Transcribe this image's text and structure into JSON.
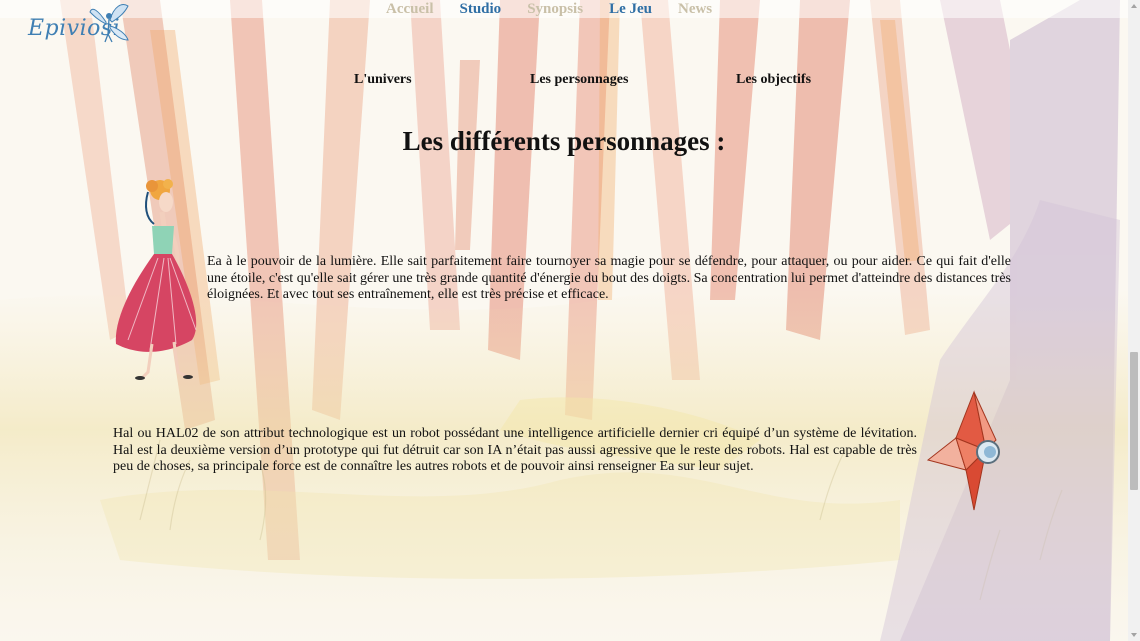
{
  "logo": {
    "text": "Epiviosi"
  },
  "nav": {
    "items": [
      {
        "label": "Accueil",
        "state": "muted"
      },
      {
        "label": "Studio",
        "state": "active"
      },
      {
        "label": "Synopsis",
        "state": "muted"
      },
      {
        "label": "Le Jeu",
        "state": "active"
      },
      {
        "label": "News",
        "state": "muted"
      }
    ]
  },
  "subnav": {
    "items": [
      {
        "label": "L'univers"
      },
      {
        "label": "Les personnages"
      },
      {
        "label": "Les objectifs"
      }
    ]
  },
  "page": {
    "title": "Les différents personnages :"
  },
  "characters": [
    {
      "illustration": "ea-character-illustration",
      "text": "Ea à le pouvoir de la lumière. Elle sait parfaitement faire tournoyer sa magie pour se défendre, pour attaquer, ou pour aider. Ce qui fait d'elle une étoile, c'est qu'elle sait gérer une très grande quantité d'énergie du bout des doigts. Sa concentration lui permet d'atteindre des distances très éloignées. Et avec tout ses entraînement, elle est très précise et efficace."
    },
    {
      "illustration": "hal-robot-illustration",
      "text": "Hal ou HAL02 de son attribut technologique est un robot possédant une intelligence artificielle dernier cri équipé d’un système de lévitation. Hal est la deuxième version d’un prototype qui fut détruit car son IA n’était pas aussi agressive que le reste des robots. Hal est capable de très peu de choses, sa principale force est de connaître les autres robots et de pouvoir ainsi renseigner Ea sur leur sujet."
    }
  ],
  "colors": {
    "nav_active": "#2f6fa5",
    "nav_muted": "#c9c0a8",
    "logo": "#3f7fb3"
  }
}
